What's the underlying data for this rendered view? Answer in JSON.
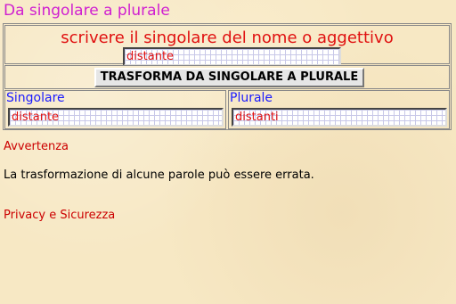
{
  "page": {
    "title": "Da singolare a plurale"
  },
  "converter": {
    "instruction": "scrivere il singolare del nome o aggettivo",
    "input_value": "distante",
    "button_label": "TRASFORMA DA SINGOLARE A PLURALE",
    "singular_label": "Singolare",
    "singular_value": "distante",
    "plural_label": "Plurale",
    "plural_value": "distanti"
  },
  "notes": {
    "warning_link": "Avvertenza",
    "warning_text": "La trasformazione di alcune parole può essere errata.",
    "privacy_link": "Privacy e Sicurezza"
  },
  "colors": {
    "title": "#d020d0",
    "accent_red": "#e01010",
    "label_blue": "#1a1aff",
    "background": "#f7e8c4"
  }
}
